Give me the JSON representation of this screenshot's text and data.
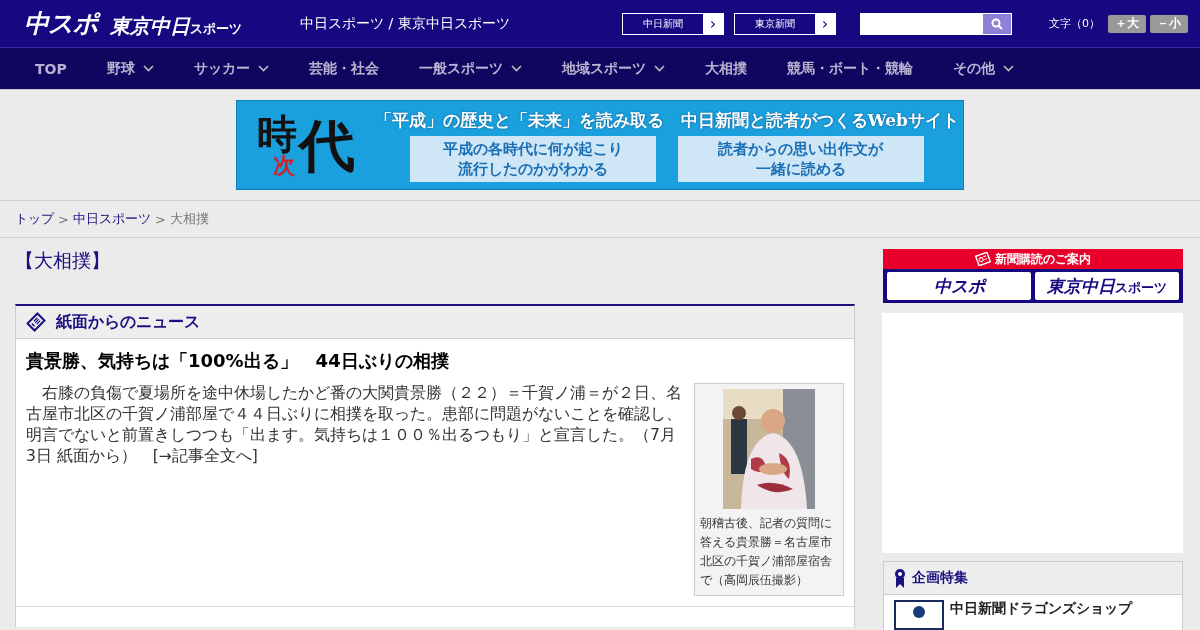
{
  "header": {
    "logo_main": "中スポ",
    "logo_sub": "東京中日",
    "logo_sub_small": "スポーツ",
    "site_title": "中日スポーツ / 東京中日スポーツ",
    "paper_links": [
      {
        "label": "中日新聞",
        "arrow": "›"
      },
      {
        "label": "東京新聞",
        "arrow": "›"
      }
    ],
    "font_size": {
      "label": "文字（0）",
      "buttons": [
        "＋大",
        "－小"
      ]
    }
  },
  "nav": [
    {
      "label": "TOP",
      "has_menu": false
    },
    {
      "label": "野球",
      "has_menu": true
    },
    {
      "label": "サッカー",
      "has_menu": true
    },
    {
      "label": "芸能・社会",
      "has_menu": false
    },
    {
      "label": "一般スポーツ",
      "has_menu": true
    },
    {
      "label": "地域スポーツ",
      "has_menu": true
    },
    {
      "label": "大相撲",
      "has_menu": false
    },
    {
      "label": "競馬・ボート・競輪",
      "has_menu": false
    },
    {
      "label": "その他",
      "has_menu": true
    }
  ],
  "banner": {
    "emblem": [
      "時",
      "次",
      "代"
    ],
    "headline": "「平成」の歴史と「未来」を読み取る　中日新聞と読者がつくるWebサイト",
    "boxes": [
      [
        "平成の各時代に何が起こり",
        "流行したのかがわかる"
      ],
      [
        "読者からの思い出作文が",
        "一緒に読める"
      ]
    ]
  },
  "breadcrumb": [
    {
      "label": "トップ",
      "link": true
    },
    {
      "label": "中日スポーツ",
      "link": true
    },
    {
      "label": "大相撲",
      "link": false
    }
  ],
  "breadcrumb_separator": ">",
  "page_title": "【大相撲】",
  "news": {
    "section_title": "紙面からのニュース",
    "headline": "貴景勝、気持ちは「100%出る」　44日ぶりの相撲",
    "body": "　右膝の負傷で夏場所を途中休場したかど番の大関貴景勝（２２）＝千賀ノ浦＝が２日、名古屋市北区の千賀ノ浦部屋で４４日ぶりに相撲を取った。患部に問題がないことを確認し、明言でないと前置きしつつも「出ます。気持ちは１００％出るつもり」と宣言した。（7月3日 紙面から）",
    "more_link": "[→記事全文へ]",
    "photo": {
      "kind": "picture",
      "caption": "朝稽古後、記者の質問に答える貴景勝＝名古屋市北区の千賀ノ浦部屋宿舎で（高岡辰伍撮影）"
    }
  },
  "sidebar": {
    "subscribe": {
      "title": "新聞購読のご案内",
      "logos": [
        {
          "main": "中スポ"
        },
        {
          "main": "東京中日",
          "small": "スポーツ"
        }
      ]
    },
    "feature": {
      "title": "企画特集",
      "items": [
        "中日新聞ドラゴンズショップ"
      ]
    }
  }
}
